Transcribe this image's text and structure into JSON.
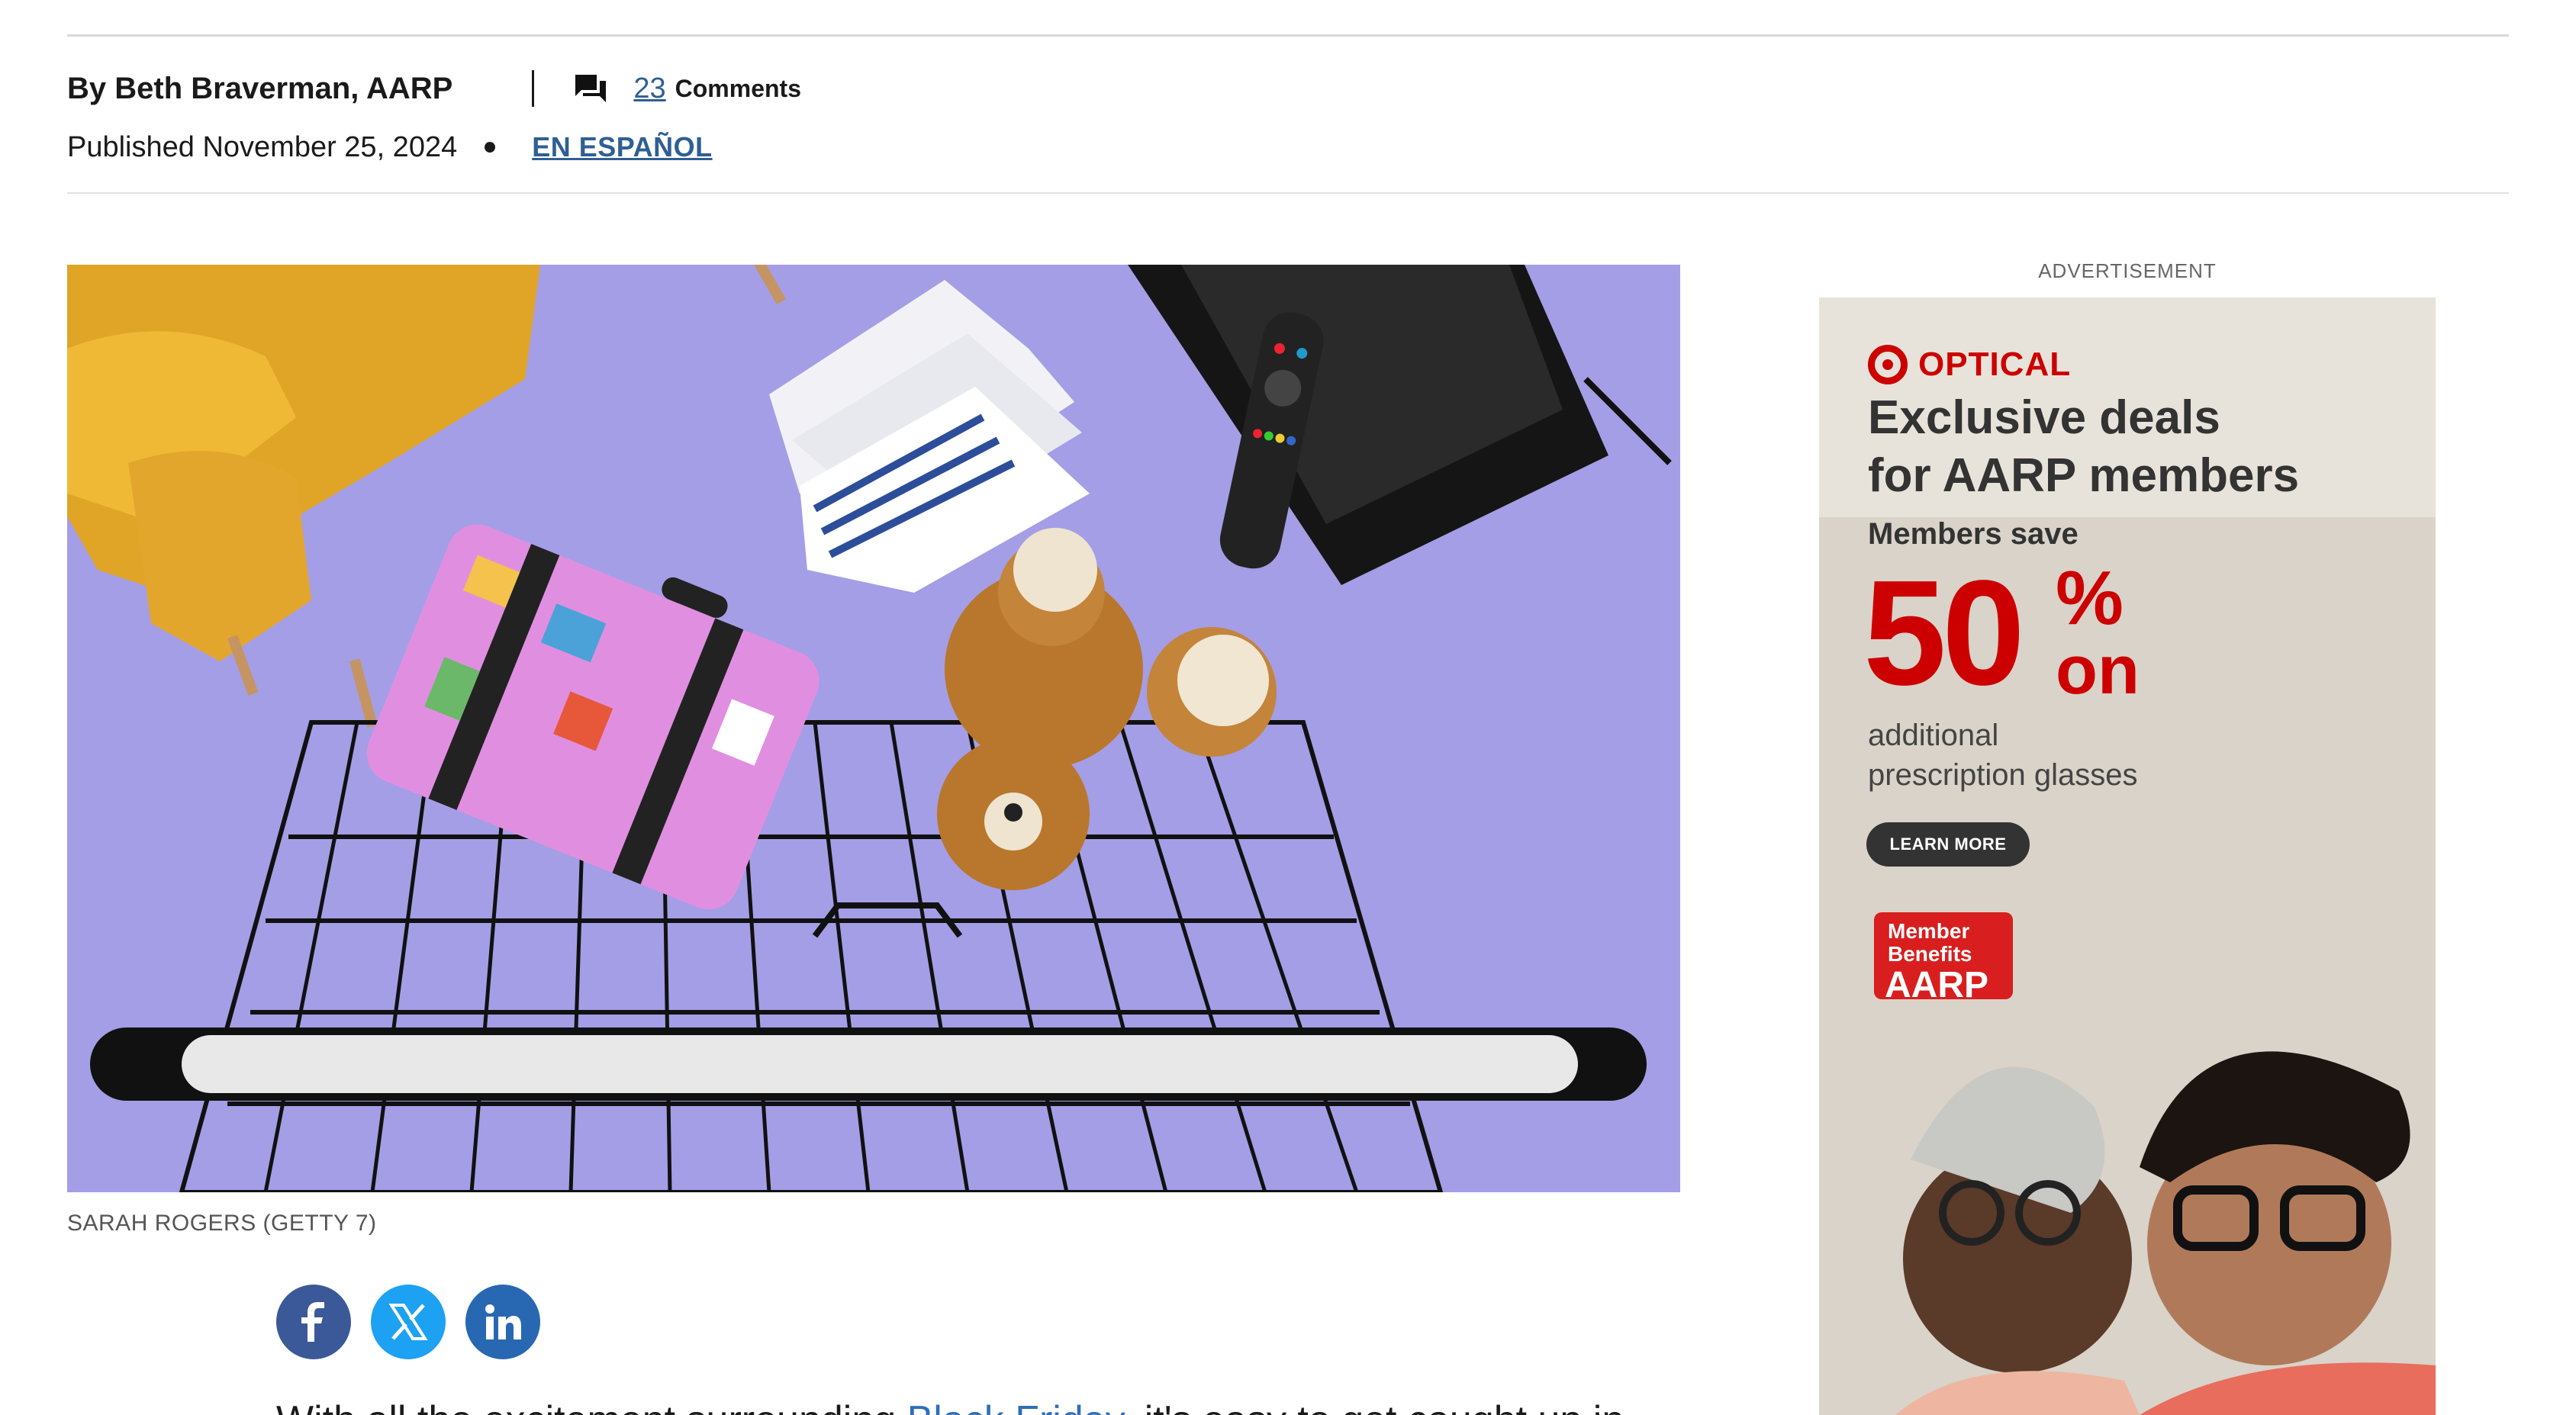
{
  "byline": {
    "author": "By Beth Braverman,  AARP",
    "comment_count": "23",
    "comment_label": "Comments",
    "published": "Published November 25, 2024",
    "language_link": "EN ESPAÑOL"
  },
  "hero": {
    "caption": "SARAH ROGERS (GETTY 7)"
  },
  "share": {
    "facebook": "f",
    "x": "𝕏",
    "linkedin": "in"
  },
  "article": {
    "lead_before": "With all the excitement surrounding ",
    "lead_link": "Black Friday",
    "lead_after": ", it's easy to get caught up in"
  },
  "ad": {
    "label": "ADVERTISEMENT",
    "brand": "OPTICAL",
    "headline_line1": "Exclusive deals",
    "headline_line2": "for AARP members",
    "members_save": "Members save",
    "percent": "50",
    "percent_sign": "%",
    "on": "on",
    "desc_line1": "additional",
    "desc_line2": "prescription glasses",
    "cta": "LEARN MORE",
    "badge_line1": "Member",
    "badge_line2": "Benefits",
    "badge_logo": "AARP"
  },
  "colors": {
    "link": "#2f5f93",
    "hero_bg": "#a49ee6",
    "ad_red": "#cc0000"
  }
}
